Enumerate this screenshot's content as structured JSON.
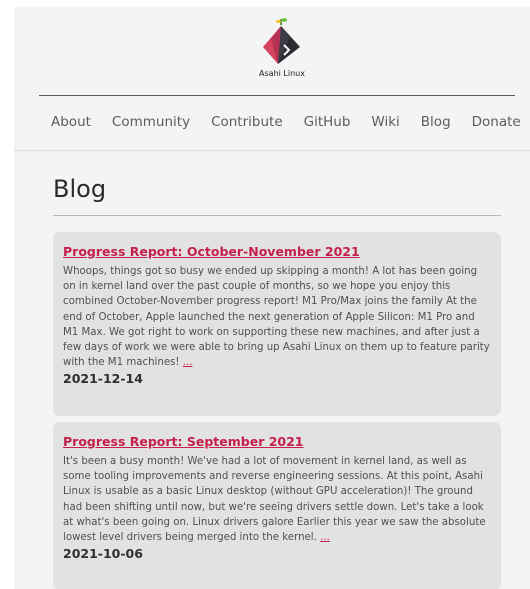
{
  "site": {
    "logo_text": "Asahi Linux"
  },
  "nav": {
    "items": [
      {
        "label": "About"
      },
      {
        "label": "Community"
      },
      {
        "label": "Contribute"
      },
      {
        "label": "GitHub"
      },
      {
        "label": "Wiki"
      },
      {
        "label": "Blog"
      },
      {
        "label": "Donate"
      }
    ]
  },
  "main": {
    "page_title": "Blog",
    "posts": [
      {
        "title": "Progress Report: October-November 2021",
        "excerpt": "Whoops, things got so busy we ended up skipping a month! A lot has been going on in kernel land over the past couple of months, so we hope you enjoy this combined October-November progress report! M1 Pro/Max joins the family At the end of October, Apple launched the next generation of Apple Silicon: M1 Pro and M1 Max. We got right to work on supporting these new machines, and after just a few days of work we were able to bring up Asahi Linux on them up to feature parity with the M1 machines!",
        "more": "...",
        "date": "2021-12-14"
      },
      {
        "title": "Progress Report: September 2021",
        "excerpt": "It's been a busy month! We've had a lot of movement in kernel land, as well as some tooling improvements and reverse engineering sessions. At this point, Asahi Linux is usable as a basic Linux desktop (without GPU acceleration)! The ground had been shifting until now, but we're seeing drivers settle down. Let's take a look at what's been going on. Linux drivers galore Earlier this year we saw the absolute lowest level drivers being merged into the kernel.",
        "more": "...",
        "date": "2021-10-06"
      }
    ]
  },
  "colors": {
    "link_accent": "#c4204a",
    "card_bg": "#e2e2e2",
    "page_bg": "#f4f4f4"
  }
}
